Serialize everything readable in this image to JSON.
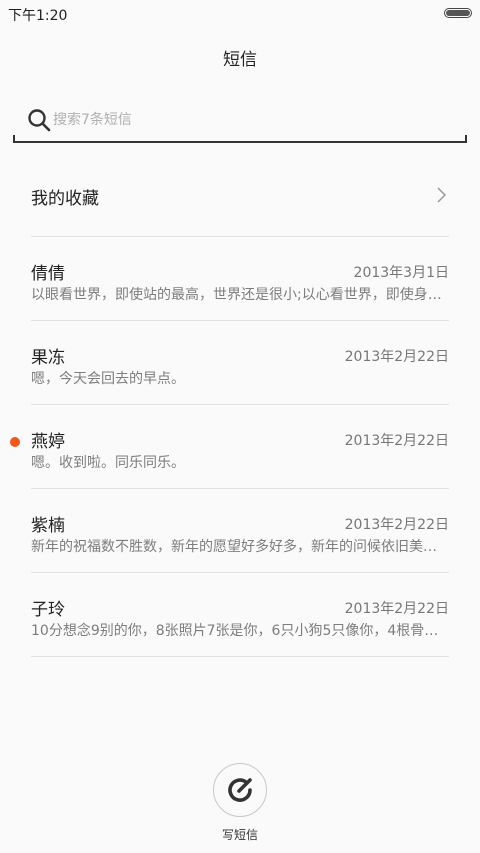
{
  "status_bar": {
    "time": "下午1:20",
    "battery_level": 1.0
  },
  "header": {
    "title": "短信"
  },
  "search": {
    "placeholder": "搜索7条短信",
    "value": ""
  },
  "favorites": {
    "label": "我的收藏"
  },
  "messages": [
    {
      "name": "倩倩",
      "date": "2013年3月1日",
      "preview": "以眼看世界，即使站的最高，世界还是很小;以心看世界，即使身…",
      "unread": false
    },
    {
      "name": "果冻",
      "date": "2013年2月22日",
      "preview": "嗯，今天会回去的早点。",
      "unread": false
    },
    {
      "name": "燕婷",
      "date": "2013年2月22日",
      "preview": "嗯。收到啦。同乐同乐。",
      "unread": true
    },
    {
      "name": "紫楠",
      "date": "2013年2月22日",
      "preview": "新年的祝福数不胜数，新年的愿望好多好多，新年的问候依旧美…",
      "unread": false
    },
    {
      "name": "子玲",
      "date": "2013年2月22日",
      "preview": "10分想念9别的你，8张照片7张是你，6只小狗5只像你，4根骨…",
      "unread": false
    }
  ],
  "compose": {
    "label": "写短信"
  },
  "colors": {
    "unread_accent": "#f0561d",
    "background": "#fafafa"
  }
}
